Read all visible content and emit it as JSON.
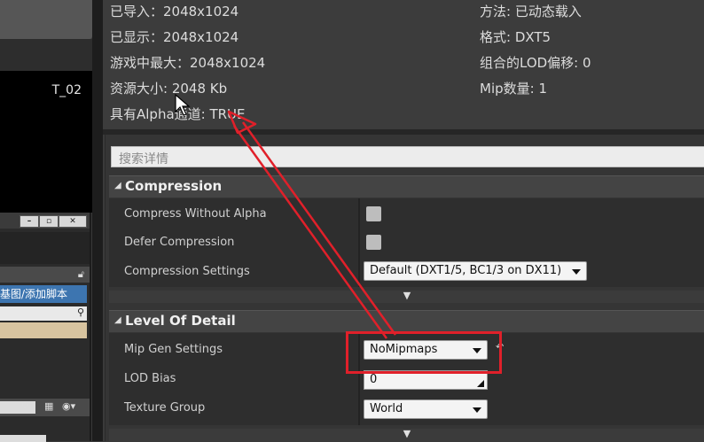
{
  "preview": {
    "texture_label": "T_02"
  },
  "sub_window": {
    "title_buttons": [
      "–",
      "▫",
      "✕"
    ],
    "blueprint_button": "基图/添加脚本"
  },
  "info": {
    "left": [
      "已导入：2048x1024",
      "已显示：2048x1024",
      "游戏中最大：2048x1024",
      "资源大小: 2048 Kb",
      "具有Alpha通道: TRUE"
    ],
    "right": [
      "方法: 已动态载入",
      "格式: DXT5",
      "组合的LOD偏移: 0",
      "Mip数量: 1"
    ]
  },
  "details": {
    "search_placeholder": "搜索详情",
    "compression": {
      "title": "Compression",
      "compress_without_alpha": {
        "label": "Compress Without Alpha",
        "checked": false
      },
      "defer_compression": {
        "label": "Defer Compression",
        "checked": false
      },
      "compression_settings": {
        "label": "Compression Settings",
        "value": "Default (DXT1/5, BC1/3 on DX11)"
      }
    },
    "level_of_detail": {
      "title": "Level Of Detail",
      "mip_gen_settings": {
        "label": "Mip Gen Settings",
        "value": "NoMipmaps"
      },
      "lod_bias": {
        "label": "LOD Bias",
        "value": "0"
      },
      "texture_group": {
        "label": "Texture Group",
        "value": "World"
      }
    }
  },
  "colors": {
    "annotation": "#e0202a",
    "accent": "#3d75b0"
  }
}
